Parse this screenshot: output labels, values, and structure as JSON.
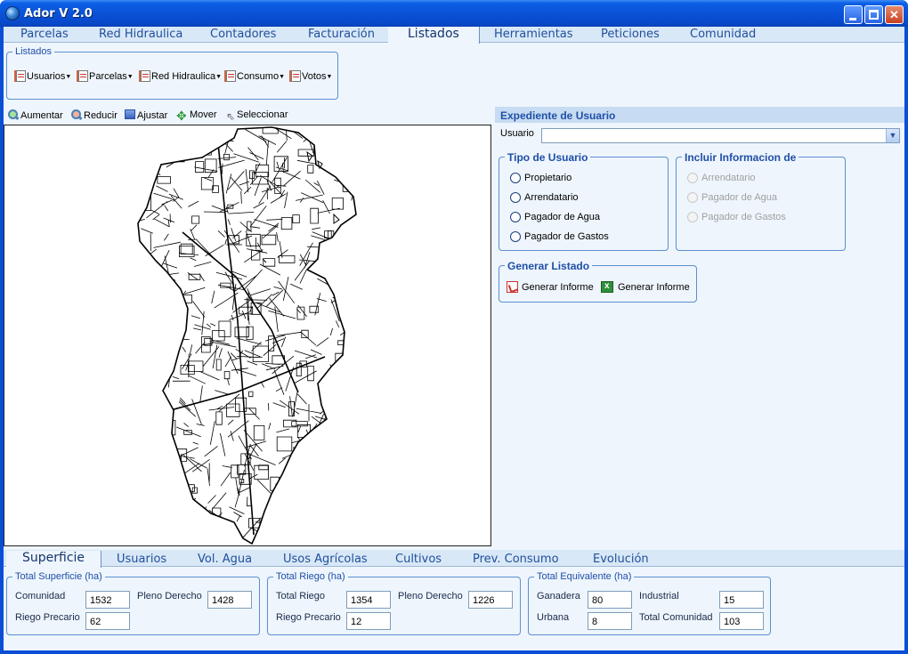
{
  "window": {
    "title": "Ador V 2.0"
  },
  "top_tabs": [
    {
      "label": "Parcelas"
    },
    {
      "label": "Red Hidraulica"
    },
    {
      "label": "Contadores"
    },
    {
      "label": "Facturación"
    },
    {
      "label": "Listados",
      "active": true
    },
    {
      "label": "Herramientas"
    },
    {
      "label": "Peticiones"
    },
    {
      "label": "Comunidad"
    }
  ],
  "listados": {
    "title": "Listados",
    "buttons": [
      {
        "label": "Usuarios"
      },
      {
        "label": "Parcelas"
      },
      {
        "label": "Red Hidraulica"
      },
      {
        "label": "Consumo"
      },
      {
        "label": "Votos"
      }
    ]
  },
  "map_toolbar": {
    "zoom_in": "Aumentar",
    "zoom_out": "Reducir",
    "fit": "Ajustar",
    "pan": "Mover",
    "select": "Seleccionar"
  },
  "expediente": {
    "title": "Expediente de Usuario",
    "usuario_label": "Usuario",
    "usuario_value": "",
    "tipo_usuario": {
      "title": "Tipo de Usuario",
      "options": [
        "Propietario",
        "Arrendatario",
        "Pagador de Agua",
        "Pagador de Gastos"
      ]
    },
    "incluir": {
      "title": "Incluir Informacion de",
      "options": [
        "Arrendatario",
        "Pagador de Agua",
        "Pagador de Gastos"
      ]
    },
    "generar": {
      "title": "Generar Listado",
      "pdf_label": "Generar Informe",
      "xls_label": "Generar Informe"
    }
  },
  "bottom_tabs": [
    {
      "label": "Superficie",
      "active": true
    },
    {
      "label": "Usuarios"
    },
    {
      "label": "Vol. Agua"
    },
    {
      "label": "Usos Agrícolas"
    },
    {
      "label": "Cultivos"
    },
    {
      "label": "Prev. Consumo"
    },
    {
      "label": "Evolución"
    }
  ],
  "totals": {
    "superficie": {
      "title": "Total Superficie (ha)",
      "comunidad_label": "Comunidad",
      "comunidad": "1532",
      "pleno_label": "Pleno Derecho",
      "pleno": "1428",
      "precario_label": "Riego Precario",
      "precario": "62"
    },
    "riego": {
      "title": "Total Riego (ha)",
      "riego_label": "Total Riego",
      "riego": "1354",
      "pleno_label": "Pleno Derecho",
      "pleno": "1226",
      "precario_label": "Riego Precario",
      "precario": "12"
    },
    "equivalente": {
      "title": "Total Equivalente (ha)",
      "ganadera_label": "Ganadera",
      "ganadera": "80",
      "industrial_label": "Industrial",
      "industrial": "15",
      "urbana_label": "Urbana",
      "urbana": "8",
      "total_label": "Total Comunidad",
      "total": "103"
    }
  },
  "colors": {
    "accent": "#1f4fa8",
    "titlebar": "#0a52d8",
    "panel": "#eef5fc"
  }
}
